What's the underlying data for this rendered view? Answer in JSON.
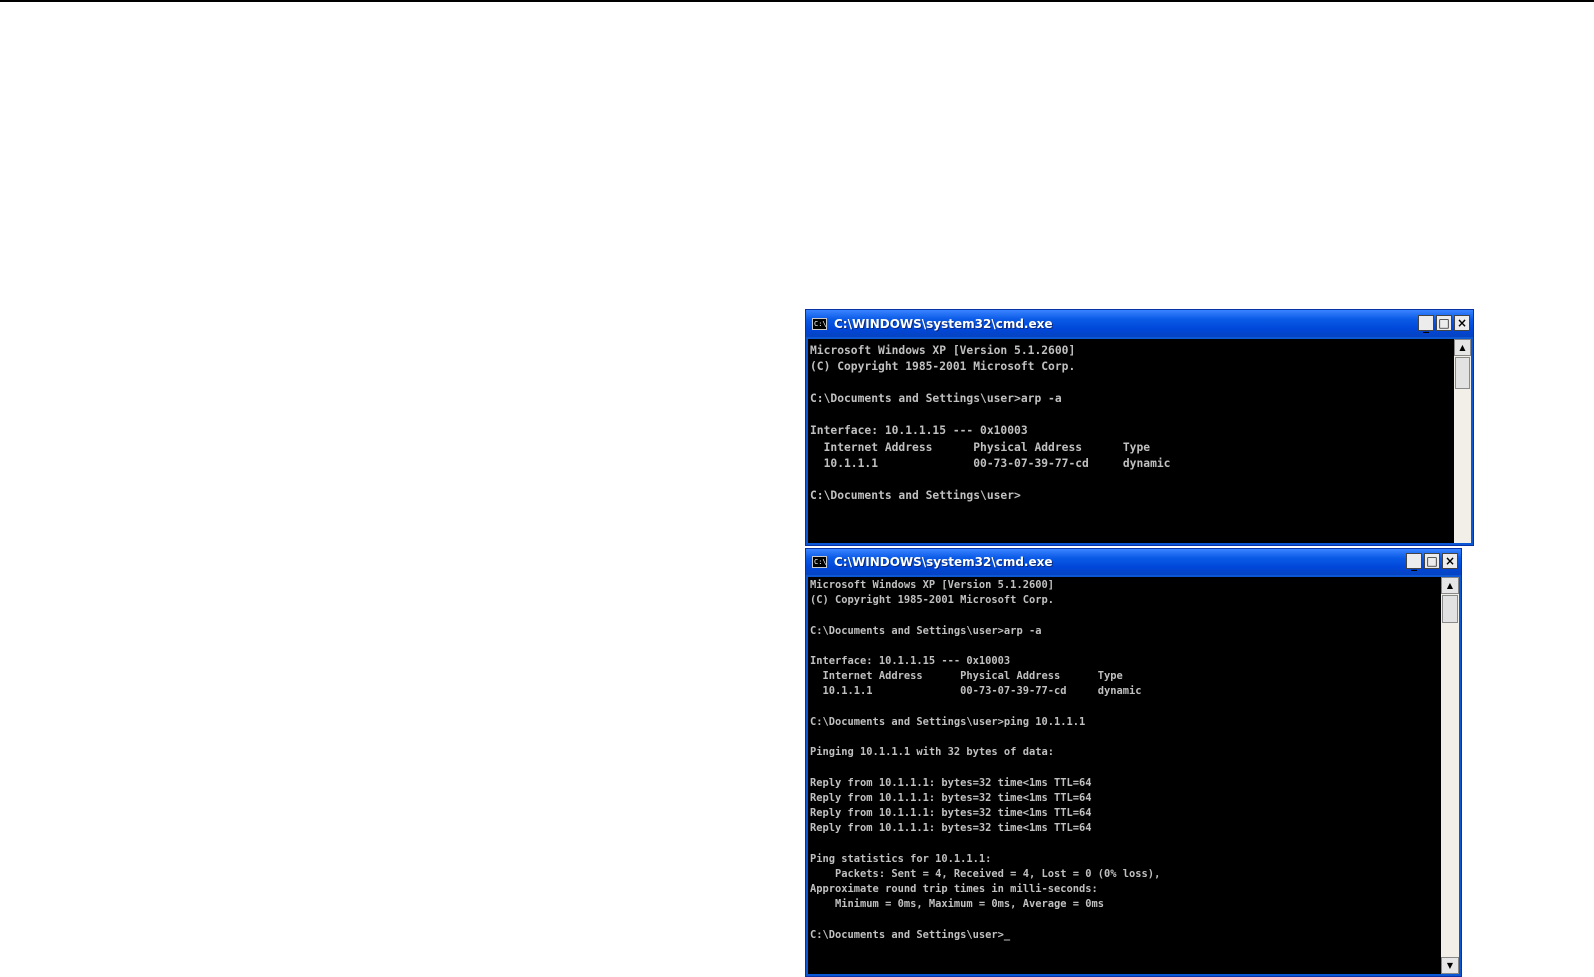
{
  "windows": [
    {
      "title": "C:\\WINDOWS\\system32\\cmd.exe",
      "icon_label": "C:\\",
      "controls": {
        "minimize": "_",
        "maximize": "□",
        "close": "×"
      },
      "console_text": "Microsoft Windows XP [Version 5.1.2600]\n(C) Copyright 1985-2001 Microsoft Corp.\n\nC:\\Documents and Settings\\user>arp -a\n\nInterface: 10.1.1.15 --- 0x10003\n  Internet Address      Physical Address      Type\n  10.1.1.1              00-73-07-39-77-cd     dynamic\n\nC:\\Documents and Settings\\user>",
      "scroll": {
        "up": "▲",
        "down": "▼"
      }
    },
    {
      "title": "C:\\WINDOWS\\system32\\cmd.exe",
      "icon_label": "C:\\",
      "controls": {
        "minimize": "_",
        "maximize": "□",
        "close": "×"
      },
      "console_text": "Microsoft Windows XP [Version 5.1.2600]\n(C) Copyright 1985-2001 Microsoft Corp.\n\nC:\\Documents and Settings\\user>arp -a\n\nInterface: 10.1.1.15 --- 0x10003\n  Internet Address      Physical Address      Type\n  10.1.1.1              00-73-07-39-77-cd     dynamic\n\nC:\\Documents and Settings\\user>ping 10.1.1.1\n\nPinging 10.1.1.1 with 32 bytes of data:\n\nReply from 10.1.1.1: bytes=32 time<1ms TTL=64\nReply from 10.1.1.1: bytes=32 time<1ms TTL=64\nReply from 10.1.1.1: bytes=32 time<1ms TTL=64\nReply from 10.1.1.1: bytes=32 time<1ms TTL=64\n\nPing statistics for 10.1.1.1:\n    Packets: Sent = 4, Received = 4, Lost = 0 (0% loss),\nApproximate round trip times in milli-seconds:\n    Minimum = 0ms, Maximum = 0ms, Average = 0ms\n\nC:\\Documents and Settings\\user>_",
      "scroll": {
        "up": "▲",
        "down": "▼"
      }
    }
  ]
}
